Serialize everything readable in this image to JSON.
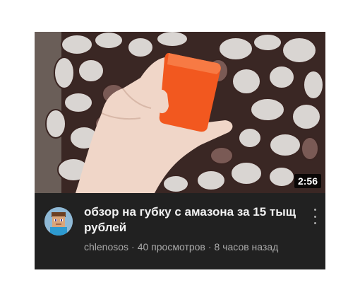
{
  "video": {
    "duration": "2:56",
    "title": "обзор на губку с амазона за 15 тыщ рублей",
    "channel": "chlenosos",
    "views": "40 просмотров",
    "age": "8 часов назад",
    "separator": "·"
  },
  "icons": {
    "more": "more-vert-icon",
    "avatar": "channel-avatar"
  },
  "colors": {
    "card_background": "#212121",
    "title_text": "#f1f1f1",
    "meta_text": "#aaaaaa",
    "sponge": "#f2581f"
  }
}
